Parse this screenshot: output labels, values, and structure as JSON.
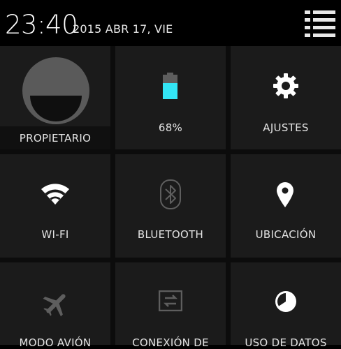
{
  "status": {
    "time": "23:40",
    "date": "2015 ABR 17, VIE"
  },
  "tiles": {
    "owner": {
      "label": "PROPIETARIO",
      "icon": "avatar-icon"
    },
    "battery": {
      "label": "68%",
      "icon": "battery-icon",
      "level_percent": 68,
      "fill_color": "#33e5f5"
    },
    "settings": {
      "label": "AJUSTES",
      "icon": "gear-icon"
    },
    "wifi": {
      "label": "WI-FI",
      "icon": "wifi-icon",
      "state": "on"
    },
    "bluetooth": {
      "label": "BLUETOOTH",
      "icon": "bluetooth-icon",
      "state": "off"
    },
    "location": {
      "label": "UBICACIÓN",
      "icon": "location-pin-icon",
      "state": "on"
    },
    "airplane": {
      "label": "MODO AVIÓN",
      "icon": "airplane-icon",
      "state": "off"
    },
    "tethering": {
      "label": "CONEXIÓN DE",
      "icon": "tethering-icon",
      "state": "off"
    },
    "data_usage": {
      "label": "USO DE DATOS",
      "icon": "data-usage-icon"
    }
  },
  "colors": {
    "background": "#000000",
    "tile": "#1b1b1b",
    "icon_active": "#ffffff",
    "icon_inactive": "#5e5e5e",
    "battery_fill": "#33e5f5"
  }
}
